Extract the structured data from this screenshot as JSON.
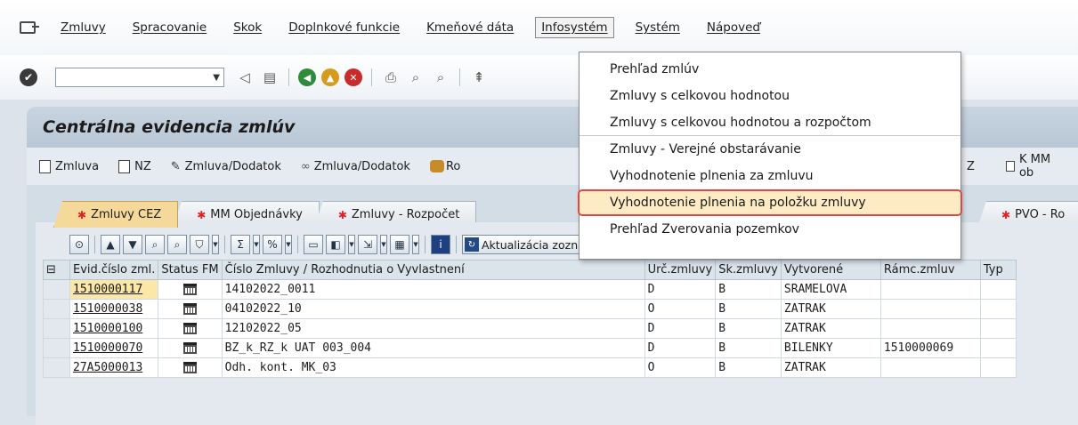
{
  "menubar": {
    "items": [
      {
        "label": "Zmluvy"
      },
      {
        "label": "Spracovanie"
      },
      {
        "label": "Skok"
      },
      {
        "label": "Doplnkové funkcie"
      },
      {
        "label": "Kmeňové dáta"
      },
      {
        "label": "Infosystém"
      },
      {
        "label": "Systém"
      },
      {
        "label": "Nápoveď"
      }
    ]
  },
  "dropdown": {
    "items": [
      {
        "label": "Prehľad zmlúv"
      },
      {
        "label": "Zmluvy s celkovou hodnotou"
      },
      {
        "label": "Zmluvy s celkovou hodnotou a rozpočtom"
      },
      {
        "label": "Zmluvy - Verejné obstarávanie"
      },
      {
        "label": "Vyhodnotenie plnenia za zmluvu"
      },
      {
        "label": "Vyhodnotenie plnenia na položku zmluvy"
      },
      {
        "label": "Prehľad Zverovania pozemkov"
      }
    ]
  },
  "page": {
    "title": "Centrálna evidencia zmlúv"
  },
  "app_toolbar": {
    "buttons": [
      {
        "label": "Zmluva"
      },
      {
        "label": "NZ"
      },
      {
        "label": "Zmluva/Dodatok"
      },
      {
        "label": "Zmluva/Dodatok"
      },
      {
        "label": "Ro"
      },
      {
        "label": "Z"
      },
      {
        "label": "K MM ob"
      }
    ]
  },
  "tabs": [
    {
      "label": "Zmluvy CEZ"
    },
    {
      "label": "MM Objednávky"
    },
    {
      "label": "Zmluvy - Rozpočet"
    },
    {
      "label": "PVO - Ro"
    }
  ],
  "alv": {
    "refresh_label": "Aktualizácia zoznamu"
  },
  "grid": {
    "columns": [
      "Evid.číslo zml.",
      "Status FM",
      "Číslo Zmluvy / Rozhodnutia o Vyvlastnení",
      "Urč.zmluvy",
      "Sk.zmluvy",
      "Vytvorené",
      "Rámc.zmluv",
      "Typ"
    ],
    "rows": [
      {
        "evid": "1510000117",
        "cislo": "14102022_0011",
        "urc": "D",
        "sk": "B",
        "vytvorene": "SRAMELOVA",
        "ramc": ""
      },
      {
        "evid": "1510000038",
        "cislo": "04102022_10",
        "urc": "O",
        "sk": "B",
        "vytvorene": "ZATRAK",
        "ramc": ""
      },
      {
        "evid": "1510000100",
        "cislo": "12102022_05",
        "urc": "D",
        "sk": "B",
        "vytvorene": "ZATRAK",
        "ramc": ""
      },
      {
        "evid": "1510000070",
        "cislo": "BZ_k_RZ_k UAT 003_004",
        "urc": "D",
        "sk": "B",
        "vytvorene": "BILENKY",
        "ramc": "1510000069"
      },
      {
        "evid": "27A5000013",
        "cislo": "Odh. kont. MK_03",
        "urc": "O",
        "sk": "B",
        "vytvorene": "ZATRAK",
        "ramc": ""
      }
    ]
  },
  "colors": {
    "highlight_border": "#e04848",
    "highlight_bg": "#fcebc3",
    "tab_active": "#f4d99a"
  }
}
